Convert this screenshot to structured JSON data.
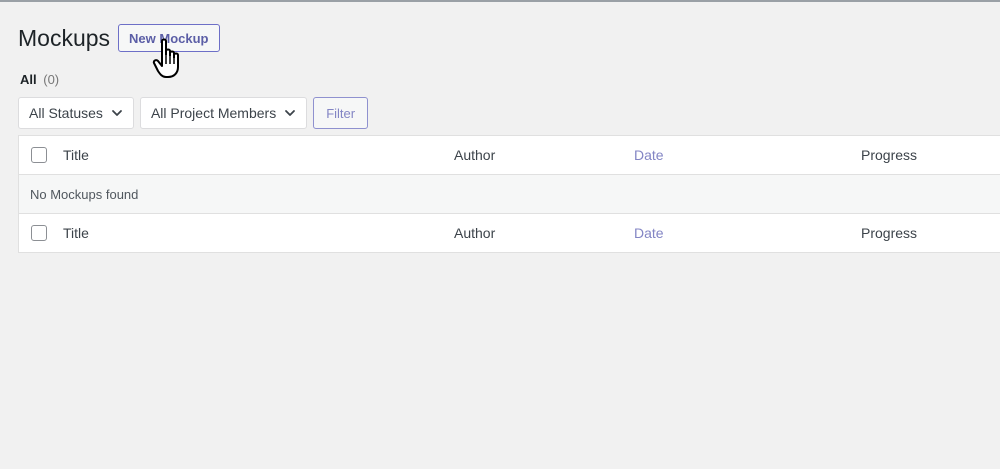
{
  "header": {
    "title": "Mockups",
    "new_button_label": "New Mockup"
  },
  "views": {
    "all_label": "All",
    "all_count": "(0)"
  },
  "filters": {
    "status_selected": "All Statuses",
    "members_selected": "All Project Members",
    "filter_button_label": "Filter"
  },
  "table": {
    "columns": {
      "title": "Title",
      "author": "Author",
      "date": "Date",
      "progress": "Progress"
    },
    "empty_message": "No Mockups found"
  },
  "colors": {
    "accent": "#6d6fc7",
    "link": "#8385c4",
    "background": "#f1f1f1"
  },
  "icons": {
    "cursor": "hand-pointer-icon",
    "dropdown": "chevron-down-icon"
  }
}
